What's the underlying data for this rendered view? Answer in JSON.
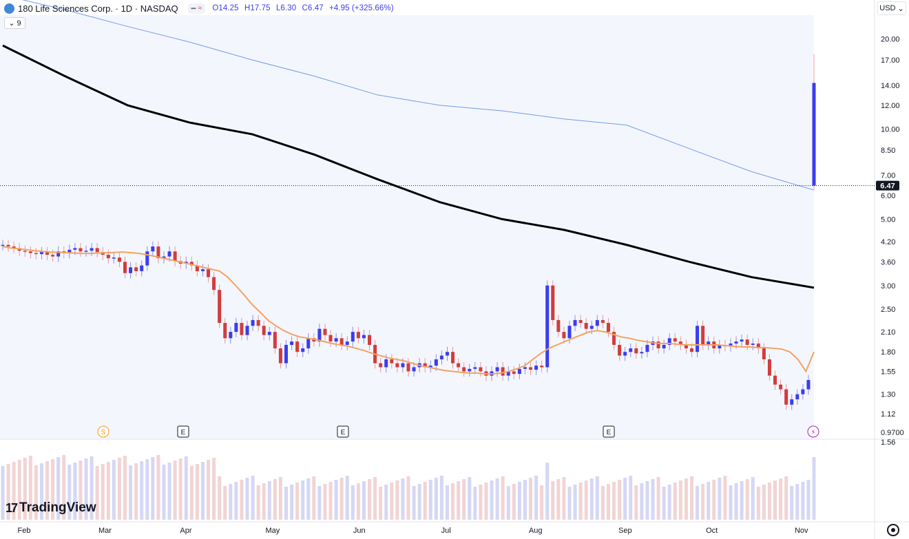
{
  "header": {
    "symbol_title": "180 Life Sciences Corp. · 1D · NASDAQ",
    "ohlc": {
      "open": "O14.25",
      "high": "H17.75",
      "low": "L6.30",
      "close": "C6.47",
      "change": "+4.95 (+325.66%)"
    },
    "indicator_toggle": "9",
    "currency": "USD"
  },
  "branding": {
    "logo_text": "TradingView"
  },
  "colors": {
    "up_candle": "#3b3df0",
    "down_candle": "#d23c3c",
    "wick_down": "#26a69a",
    "sma_long": "#000000",
    "sma_short": "#f4a261",
    "sma_mid": "#6f9de8",
    "volume": "#d7dbec",
    "last_price_badge": "#131722",
    "earnings_marker": "#131722",
    "split_marker": "#f59e1b",
    "news_marker": "#9c27b0"
  },
  "chart_data": {
    "type": "candlestick",
    "title": "180 Life Sciences Corp. · 1D · NASDAQ",
    "scale": "log",
    "ylim": [
      0.92,
      24
    ],
    "price_ticks": [
      "20.00",
      "17.00",
      "14.00",
      "12.00",
      "10.00",
      "8.50",
      "7.00",
      "6.00",
      "5.00",
      "4.20",
      "3.60",
      "3.00",
      "2.50",
      "2.10",
      "1.80",
      "1.55",
      "1.30",
      "1.12",
      "0.9700"
    ],
    "last_price": "6.47",
    "volume_axis_label": "1.56",
    "x_labels": [
      "Feb",
      "Mar",
      "Apr",
      "May",
      "Jun",
      "Jul",
      "Aug",
      "Sep",
      "Oct",
      "Nov"
    ],
    "events": [
      {
        "label": "S",
        "date": "Mar 1",
        "kind": "split"
      },
      {
        "label": "E",
        "date": "Mar 29",
        "kind": "earnings"
      },
      {
        "label": "E",
        "date": "May 16",
        "kind": "earnings"
      },
      {
        "label": "E",
        "date": "Aug 14",
        "kind": "earnings"
      },
      {
        "label": "⚡",
        "date": "Oct 16",
        "kind": "news"
      }
    ],
    "closes": [
      4.1,
      4.05,
      4.0,
      3.92,
      3.9,
      3.85,
      3.82,
      3.88,
      3.8,
      3.75,
      3.9,
      3.85,
      3.95,
      4.0,
      3.9,
      3.92,
      4.0,
      3.88,
      3.8,
      3.7,
      3.72,
      3.6,
      3.3,
      3.45,
      3.35,
      3.5,
      3.9,
      4.05,
      3.7,
      3.75,
      3.9,
      3.62,
      3.55,
      3.6,
      3.5,
      3.35,
      3.4,
      3.2,
      2.9,
      2.25,
      2.0,
      2.1,
      2.25,
      2.05,
      2.2,
      2.3,
      2.2,
      2.05,
      2.1,
      1.85,
      1.65,
      1.9,
      1.95,
      1.8,
      1.85,
      2.0,
      1.95,
      2.15,
      2.05,
      1.95,
      2.0,
      1.9,
      1.95,
      2.1,
      2.0,
      2.05,
      1.9,
      1.65,
      1.6,
      1.7,
      1.65,
      1.6,
      1.65,
      1.55,
      1.6,
      1.65,
      1.6,
      1.62,
      1.7,
      1.75,
      1.8,
      1.65,
      1.6,
      1.55,
      1.58,
      1.6,
      1.55,
      1.5,
      1.55,
      1.6,
      1.5,
      1.55,
      1.52,
      1.58,
      1.6,
      1.57,
      1.62,
      1.6,
      3.0,
      2.3,
      2.1,
      2.0,
      2.2,
      2.3,
      2.25,
      2.15,
      2.2,
      2.3,
      2.25,
      2.1,
      1.9,
      1.75,
      1.8,
      1.85,
      1.78,
      1.8,
      1.9,
      1.95,
      1.85,
      1.9,
      2.0,
      1.95,
      1.9,
      1.85,
      1.8,
      2.2,
      1.9,
      1.95,
      1.85,
      1.9,
      1.88,
      1.92,
      1.95,
      1.98,
      1.9,
      1.92,
      1.85,
      1.7,
      1.5,
      1.4,
      1.35,
      1.2,
      1.25,
      1.3,
      1.35,
      1.45,
      6.47
    ],
    "sma_short": [
      4.05,
      4.0,
      3.98,
      3.95,
      3.92,
      3.9,
      3.88,
      3.87,
      3.86,
      3.85,
      3.84,
      3.84,
      3.85,
      3.86,
      3.87,
      3.88,
      3.86,
      3.84,
      3.8,
      3.75,
      3.7,
      3.65,
      3.6,
      3.55,
      3.5,
      3.45,
      3.4,
      3.35,
      3.2,
      3.0,
      2.8,
      2.6,
      2.45,
      2.3,
      2.2,
      2.12,
      2.06,
      2.02,
      2.0,
      1.98,
      1.95,
      1.92,
      1.9,
      1.88,
      1.85,
      1.82,
      1.78,
      1.75,
      1.72,
      1.7,
      1.68,
      1.65,
      1.62,
      1.6,
      1.58,
      1.56,
      1.55,
      1.54,
      1.53,
      1.53,
      1.52,
      1.52,
      1.53,
      1.55,
      1.58,
      1.62,
      1.7,
      1.78,
      1.85,
      1.9,
      1.95,
      2.0,
      2.05,
      2.1,
      2.12,
      2.1,
      2.06,
      2.02,
      2.0,
      1.97,
      1.95,
      1.93,
      1.92,
      1.92,
      1.91,
      1.9,
      1.9,
      1.9,
      1.9,
      1.9,
      1.89,
      1.88,
      1.87,
      1.87,
      1.86,
      1.86,
      1.85,
      1.84,
      1.8,
      1.7,
      1.55,
      1.8
    ],
    "sma_mid": [
      28,
      25,
      22,
      19.5,
      17,
      15,
      13,
      12,
      11.5,
      10.8,
      10.3,
      8.6,
      7.2,
      6.25
    ],
    "sma_long": [
      19,
      15,
      12,
      10.5,
      9.6,
      8.2,
      6.8,
      5.7,
      5.0,
      4.6,
      4.1,
      3.6,
      3.2,
      2.95
    ]
  }
}
